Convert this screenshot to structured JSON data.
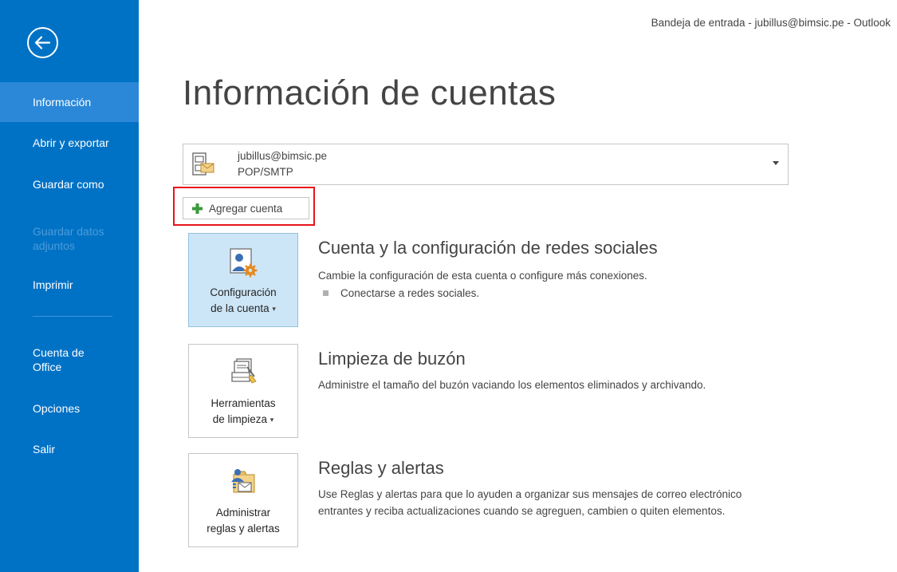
{
  "window_title": "Bandeja de entrada - jubillus@bimsic.pe - Outlook",
  "sidebar": {
    "back_icon": "back-arrow-icon",
    "items": [
      {
        "label": "Información",
        "state": "active"
      },
      {
        "label": "Abrir y exportar",
        "state": "normal"
      },
      {
        "label": "Guardar como",
        "state": "normal"
      },
      {
        "label": "Guardar datos adjuntos",
        "state": "disabled"
      },
      {
        "label": "Imprimir",
        "state": "normal"
      },
      {
        "label": "Cuenta de Office",
        "state": "normal"
      },
      {
        "label": "Opciones",
        "state": "normal"
      },
      {
        "label": "Salir",
        "state": "normal"
      }
    ]
  },
  "page_title": "Información de cuentas",
  "account": {
    "email": "jubillus@bimsic.pe",
    "type": "POP/SMTP",
    "icon": "account-mail-icon",
    "dropdown_icon": "dropdown-caret-icon"
  },
  "add_account": {
    "label": "Agregar cuenta",
    "icon": "plus-icon",
    "highlighted": true
  },
  "sections": [
    {
      "tile_label_line1": "Configuración",
      "tile_label_line2": "de la cuenta",
      "tile_icon": "account-settings-icon",
      "title": "Cuenta y la configuración de redes sociales",
      "description": "Cambie la configuración de esta cuenta o configure más conexiones.",
      "bullet": "Conectarse a redes sociales."
    },
    {
      "tile_label_line1": "Herramientas",
      "tile_label_line2": "de limpieza",
      "tile_icon": "cleanup-tools-icon",
      "title": "Limpieza de buzón",
      "description": "Administre el tamaño del buzón vaciando los elementos eliminados y archivando."
    },
    {
      "tile_label_line1": "Administrar",
      "tile_label_line2": "reglas y alertas",
      "tile_icon": "rules-alerts-icon",
      "title": "Reglas y alertas",
      "description": "Use Reglas y alertas para que lo ayuden a organizar sus mensajes de correo electrónico entrantes y reciba actualizaciones cuando se agreguen, cambien o quiten elementos."
    }
  ],
  "colors": {
    "sidebar": "#0072c6",
    "sidebar_active": "#2b88d8",
    "tile_selected": "#cde6f7",
    "highlight": "#e8141b"
  }
}
